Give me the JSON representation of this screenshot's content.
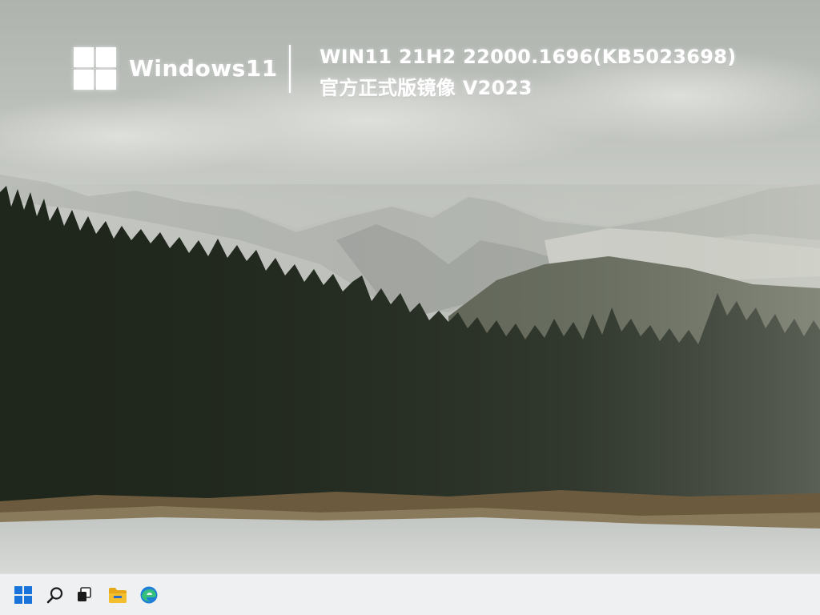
{
  "branding": {
    "logo_icon": "windows-logo-icon",
    "product_name": "Windows11",
    "version_line": "WIN11 21H2 22000.1696(KB5023698)",
    "subtitle_line": "官方正式版镜像 V2023"
  },
  "wallpaper": {
    "scene": "mountains-forest-lake"
  },
  "taskbar": {
    "items": [
      {
        "name": "start-button",
        "icon": "windows-start-icon"
      },
      {
        "name": "search-button",
        "icon": "search-icon"
      },
      {
        "name": "task-view-button",
        "icon": "task-view-icon"
      },
      {
        "name": "file-explorer-button",
        "icon": "folder-icon"
      },
      {
        "name": "edge-browser-button",
        "icon": "edge-icon"
      }
    ],
    "colors": {
      "background": "#eef0f2",
      "start_blue": "#1a73d9",
      "folder_yellow": "#f3bf2e",
      "edge_blue": "#1f7fd8",
      "edge_green": "#35c17a"
    }
  }
}
